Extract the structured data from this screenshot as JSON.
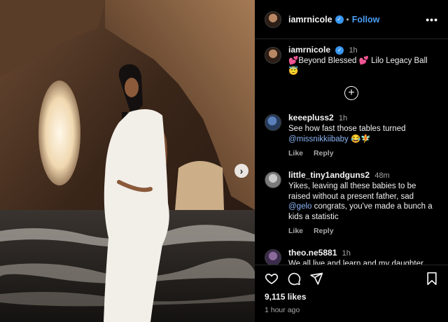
{
  "post": {
    "username": "iamrnicole",
    "follow_label": "Follow",
    "separator": "•",
    "more_label": "•••",
    "caption": {
      "username": "iamrnicole",
      "time": "1h",
      "text": "💕Beyond Blessed 💕 Lilo Legacy Ball 😇"
    },
    "likes": "9,115 likes",
    "time_ago": "1 hour ago"
  },
  "comments": [
    {
      "username": "keeepluss2",
      "time": "1h",
      "text": "See how fast those tables turned",
      "mention": "@missnikkiibaby",
      "text_after": " 😂🧚",
      "like_label": "Like",
      "reply_label": "Reply"
    },
    {
      "username": "little_tiny1andguns2",
      "time": "48m",
      "text": "Yikes, leaving all these babies to be raised without a present father, sad",
      "mention": "@gelo",
      "text_after": " congrats, you've made a bunch a kids a statistic",
      "like_label": "Like",
      "reply_label": "Reply"
    },
    {
      "username": "theo.ne5881",
      "time": "1h",
      "text": "We all live and learn and my daughter"
    }
  ],
  "colors": {
    "background": "#000000",
    "link_blue": "#4a9ff5",
    "mention_blue": "#8cb6f5",
    "muted_text": "#a8a8a8",
    "verified": "#3897f0"
  },
  "icons": {
    "verified": "verified-badge-icon",
    "add_comment": "plus-circle-icon",
    "carousel_next": "chevron-right-icon",
    "like": "heart-icon",
    "comment": "comment-icon",
    "share": "share-icon",
    "save": "bookmark-icon"
  },
  "glyphs": {
    "verified": "✓",
    "plus": "+",
    "next": "›"
  }
}
